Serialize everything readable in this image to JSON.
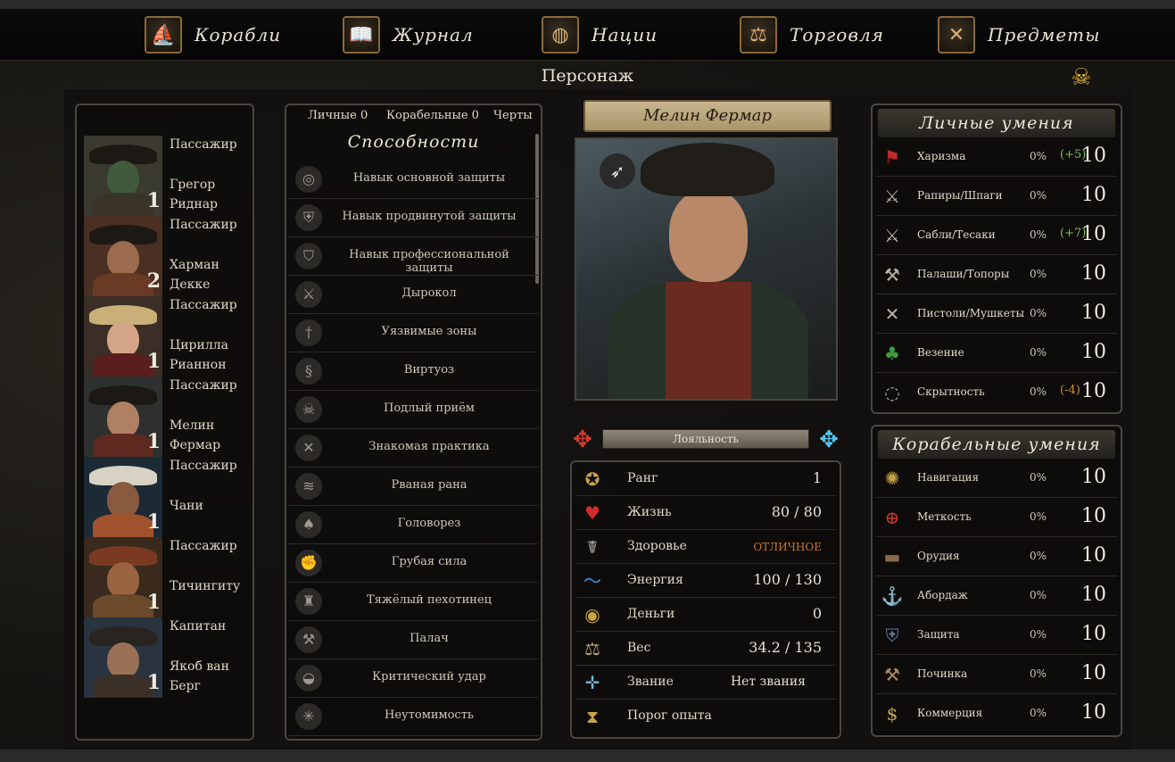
{
  "nav": [
    {
      "label": "Корабли",
      "icon": "ship-icon"
    },
    {
      "label": "Журнал",
      "icon": "book-icon"
    },
    {
      "label": "Нации",
      "icon": "globe-icon"
    },
    {
      "label": "Торговля",
      "icon": "scales-icon"
    },
    {
      "label": "Предметы",
      "icon": "crossed-swords-icon"
    }
  ],
  "page_title": "Персонаж",
  "party": [
    {
      "role": "Пассажир",
      "name": "Грегор Риднар",
      "num": "1"
    },
    {
      "role": "Пассажир",
      "name": "Харман Декке",
      "num": "2"
    },
    {
      "role": "Пассажир",
      "name": "Цирилла Рианнон",
      "num": "1"
    },
    {
      "role": "Пассажир",
      "name": "Мелин Фермар",
      "num": "1"
    },
    {
      "role": "Пассажир",
      "name": "Чани",
      "num": "1"
    },
    {
      "role": "Пассажир",
      "name": "Тичингиту",
      "num": "1"
    },
    {
      "role": "Капитан",
      "name": "Якоб ван Берг",
      "num": "1"
    }
  ],
  "abilities": {
    "tabs": [
      "Личные 0",
      "Корабельные 0",
      "Черты"
    ],
    "heading": "Способности",
    "items": [
      "Навык основной защиты",
      "Навык продвинутой защиты",
      "Навык профессиональной защиты",
      "Дырокол",
      "Уязвимые зоны",
      "Виртуоз",
      "Подлый приём",
      "Знакомая практика",
      "Рваная рана",
      "Головорез",
      "Грубая сила",
      "Тяжёлый пехотинец",
      "Палач",
      "Критический удар",
      "Неутомимость"
    ]
  },
  "character": {
    "name": "Мелин Фермар",
    "loyalty_label": "Лояльность",
    "stats": [
      {
        "label": "Ранг",
        "value": "1",
        "icon": "star-badge-icon"
      },
      {
        "label": "Жизнь",
        "value": "80 / 80",
        "icon": "heart-icon"
      },
      {
        "label": "Здоровье",
        "value": "ОТЛИЧНОЕ",
        "icon": "caduceus-icon"
      },
      {
        "label": "Энергия",
        "value": "100 / 130",
        "icon": "energy-icon"
      },
      {
        "label": "Деньги",
        "value": "0",
        "icon": "coins-icon"
      },
      {
        "label": "Вес",
        "value": "34.2 / 135",
        "icon": "scales-icon"
      },
      {
        "label": "Звание",
        "value": "Нет звания",
        "icon": "rank-cross-icon"
      },
      {
        "label": "Порог опыта",
        "value": "",
        "icon": "hourglass-icon"
      }
    ]
  },
  "personal_skills": {
    "heading": "Личные умения",
    "items": [
      {
        "label": "Харизма",
        "pct": "0%",
        "bonus": "(+5)",
        "value": "10",
        "icon": "flag-icon"
      },
      {
        "label": "Рапиры/Шпаги",
        "pct": "0%",
        "bonus": "",
        "value": "10",
        "icon": "rapier-icon"
      },
      {
        "label": "Сабли/Тесаки",
        "pct": "0%",
        "bonus": "(+7)",
        "value": "10",
        "icon": "sabre-icon"
      },
      {
        "label": "Палаши/Топоры",
        "pct": "0%",
        "bonus": "",
        "value": "10",
        "icon": "axe-icon"
      },
      {
        "label": "Пистоли/Мушкеты",
        "pct": "0%",
        "bonus": "",
        "value": "10",
        "icon": "pistol-icon"
      },
      {
        "label": "Везение",
        "pct": "0%",
        "bonus": "",
        "value": "10",
        "icon": "clover-icon"
      },
      {
        "label": "Скрытность",
        "pct": "0%",
        "bonus": "(-4)",
        "value": "10",
        "icon": "mask-icon"
      }
    ]
  },
  "ship_skills": {
    "heading": "Корабельные умения",
    "items": [
      {
        "label": "Навигация",
        "pct": "0%",
        "value": "10",
        "icon": "compass-icon"
      },
      {
        "label": "Меткость",
        "pct": "0%",
        "value": "10",
        "icon": "crosshair-icon"
      },
      {
        "label": "Орудия",
        "pct": "0%",
        "value": "10",
        "icon": "cannon-icon"
      },
      {
        "label": "Абордаж",
        "pct": "0%",
        "value": "10",
        "icon": "grapple-icon"
      },
      {
        "label": "Защита",
        "pct": "0%",
        "value": "10",
        "icon": "shield-icon"
      },
      {
        "label": "Починка",
        "pct": "0%",
        "value": "10",
        "icon": "hammer-icon"
      },
      {
        "label": "Коммерция",
        "pct": "0%",
        "value": "10",
        "icon": "money-bag-icon"
      }
    ]
  },
  "colors": {
    "bonus_positive": "#7fbf5a",
    "bonus_negative": "#d88a3a",
    "health_text": "#c7742a"
  }
}
